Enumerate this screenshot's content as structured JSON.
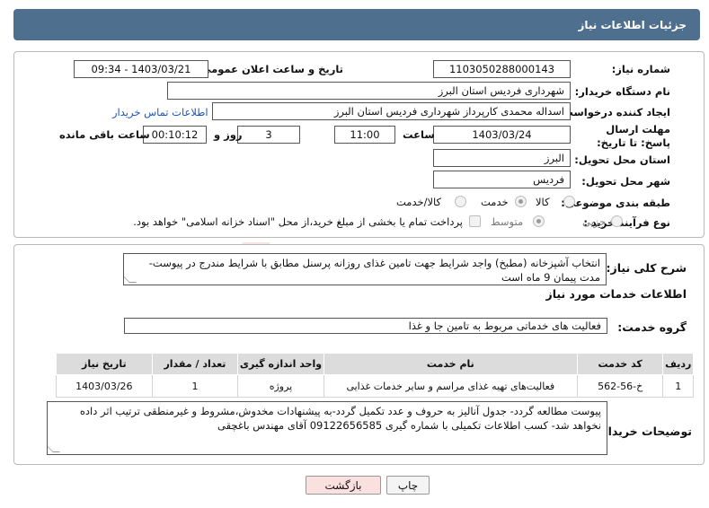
{
  "header": {
    "title": "جزئیات اطلاعات نیاز"
  },
  "form": {
    "need_number": {
      "label": "شماره نیاز:",
      "value": "1103050288000143"
    },
    "announce_datetime": {
      "label": "تاریخ و ساعت اعلان عمومی:",
      "value": "1403/03/21 - 09:34"
    },
    "buyer_org": {
      "label": "نام دستگاه خریدار:",
      "value": "شهرداری فردیس استان البرز"
    },
    "request_creator": {
      "label": "ایجاد کننده درخواست:",
      "value": "اسداله محمدی کارپرداز شهرداری فردیس استان البرز",
      "contact_link": "اطلاعات تماس خریدار"
    },
    "deadline": {
      "label": "مهلت ارسال پاسخ: تا تاریخ:",
      "date": "1403/03/24",
      "time_label": "ساعت",
      "time": "11:00",
      "days": "3",
      "days_label": "روز و",
      "remaining": "00:10:12",
      "remaining_label": "ساعت باقی مانده"
    },
    "province": {
      "label": "استان محل تحویل:",
      "value": "البرز"
    },
    "city": {
      "label": "شهر محل تحویل:",
      "value": "فردیس"
    },
    "category": {
      "label": "طبقه بندی موضوعی:",
      "options": [
        "کالا",
        "خدمت",
        "کالا/خدمت"
      ],
      "selected": "خدمت"
    },
    "process": {
      "label": "نوع فرآیند خرید :",
      "options": [
        "جزیی",
        "متوسط"
      ],
      "selected": "متوسط",
      "payment_note": "پرداخت تمام یا بخشی از مبلغ خرید،از محل \"اسناد خزانه اسلامی\" خواهد بود."
    }
  },
  "description": {
    "label": "شرح کلی نیاز:",
    "text": "انتخاب آشپزخانه (مطبخ) واجد شرایط جهت تامین غذای روزانه پرسنل مطابق با شرایط مندرج در پیوست-مدت پیمان 9 ماه است"
  },
  "services": {
    "section_title": "اطلاعات خدمات مورد نیاز",
    "group_label": "گروه خدمت:",
    "group_value": "فعالیت های خدماتی مربوط به تامین جا و غذا",
    "columns": [
      "ردیف",
      "کد خدمت",
      "نام خدمت",
      "واحد اندازه گیری",
      "تعداد / مقدار",
      "تاریخ نیاز"
    ],
    "rows": [
      {
        "row": "1",
        "code": "خ-56-562",
        "name": "فعالیت‌های تهیه غذای مراسم و سایر خدمات غذایی",
        "unit": "پروژه",
        "qty": "1",
        "date": "1403/03/26"
      }
    ]
  },
  "buyer_notes": {
    "label": "توضیحات خریدار:",
    "text": "پیوست مطالعه گردد- جدول آنالیز به حروف و عدد تکمیل گردد-به پیشنهادات مخدوش،مشروط و غیرمنطقی ترتیب اثر داده نخواهد شد- کسب اطلاعات تکمیلی با شماره گیری 09122656585 آقای مهندس باغچقی"
  },
  "buttons": {
    "print": "چاپ",
    "back": "بازگشت"
  },
  "watermark": {
    "text": "AriaTender.neT"
  },
  "colors": {
    "header_bg": "#4f6f8f",
    "link": "#1a55c8",
    "back_button": "#fbe0e0"
  }
}
